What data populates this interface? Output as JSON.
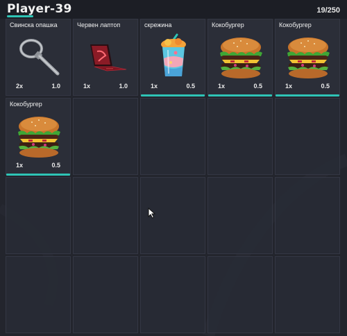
{
  "header": {
    "player_name": "Player-39",
    "slots_used": "19/250",
    "accent_color": "#2ec4b6"
  },
  "slots": [
    {
      "name": "Свинска опашка",
      "qty": "2x",
      "weight": "1.0",
      "icon": "zip-tie-icon",
      "durability_bar": false
    },
    {
      "name": "Червен лаптоп",
      "qty": "1x",
      "weight": "1.0",
      "icon": "red-laptop-icon",
      "durability_bar": false
    },
    {
      "name": "скрежина",
      "qty": "1x",
      "weight": "0.5",
      "icon": "slushie-cup-icon",
      "durability_bar": true
    },
    {
      "name": "Кокобургер",
      "qty": "1x",
      "weight": "0.5",
      "icon": "burger-icon",
      "durability_bar": true
    },
    {
      "name": "Кокобургер",
      "qty": "1x",
      "weight": "0.5",
      "icon": "burger-icon",
      "durability_bar": true
    },
    {
      "name": "Кокобургер",
      "qty": "1x",
      "weight": "0.5",
      "icon": "burger-icon",
      "durability_bar": true
    }
  ],
  "total_visible_slots": 20
}
